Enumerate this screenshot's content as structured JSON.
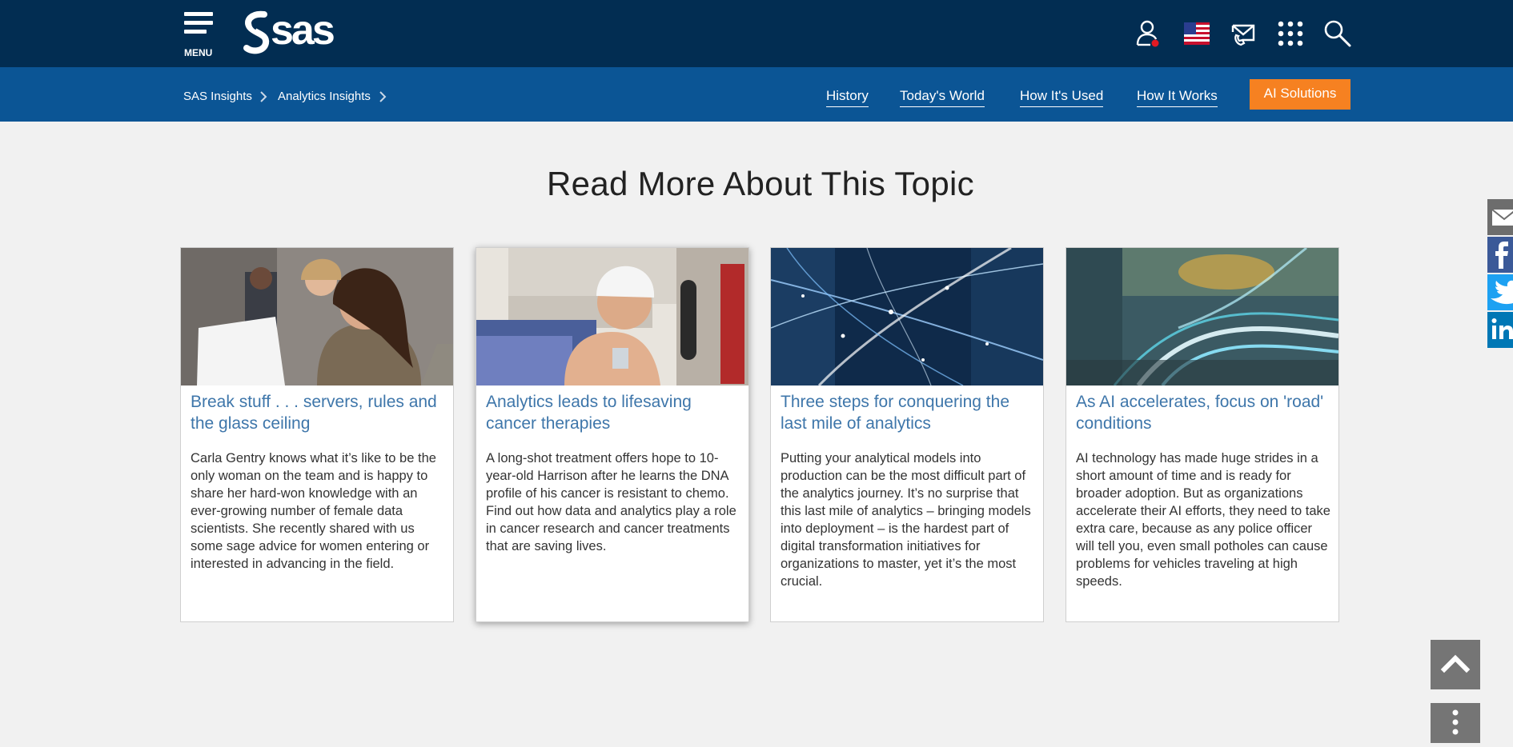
{
  "header": {
    "menu_label": "MENU",
    "logo_text": "sas",
    "icons": [
      "account-icon",
      "us-flag-icon",
      "contact-icon",
      "apps-grid-icon",
      "search-icon"
    ],
    "status_dot_color": "#e21a23"
  },
  "subnav": {
    "breadcrumbs": [
      "SAS Insights",
      "Analytics Insights"
    ],
    "links": [
      "History",
      "Today's World",
      "How It's Used",
      "How It Works"
    ],
    "cta_label": "AI Solutions",
    "cta_color": "#f68121"
  },
  "main": {
    "section_title": "Read More About This Topic",
    "cards": [
      {
        "title": "Break stuff . . . servers, rules and the glass ceiling",
        "body": "Carla Gentry knows what it’s like to be the only woman on the team and is happy to share her hard-won knowledge with an ever-growing number of female data scientists. She recently shared with us some sage advice for women entering or interested in advancing in the field."
      },
      {
        "title": "Analytics leads to lifesaving cancer therapies",
        "body": "A long-shot treatment offers hope to 10-year-old Harrison after he learns the DNA profile of his cancer is resistant to chemo. Find out how data and analytics play a role in cancer research and cancer treatments that are saving lives."
      },
      {
        "title": "Three steps for conquering the last mile of analytics",
        "body": "Putting your analytical models into production can be the most difficult part of the analytics journey. It’s no surprise that this last mile of analytics – bringing models into deployment – is the hardest part of digital transformation initiatives for organizations to master, yet it’s the most crucial."
      },
      {
        "title": "As AI accelerates, focus on 'road' conditions",
        "body": "AI technology has made huge strides in a short amount of time and is ready for broader adoption. But as organizations accelerate their AI efforts, they need to take extra care, because as any police officer will tell you, even small potholes can cause problems for vehicles traveling at high speeds."
      }
    ]
  },
  "social": [
    "email-share-icon",
    "facebook-share-icon",
    "twitter-share-icon",
    "linkedin-share-icon"
  ],
  "colors": {
    "header_bg": "#022d52",
    "subnav_bg": "#0b5595",
    "link_blue": "#3e76aa",
    "page_bg": "#f1f1f1"
  }
}
